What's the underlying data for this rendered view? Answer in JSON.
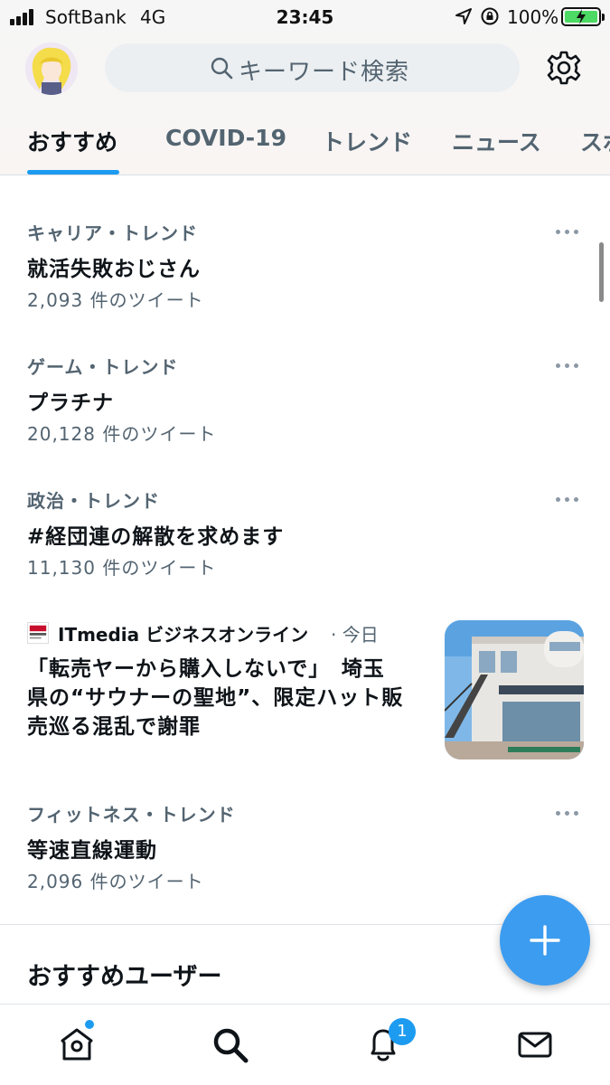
{
  "status_bar": {
    "carrier": "SoftBank",
    "network": "4G",
    "time": "23:45",
    "battery_percent": "100%"
  },
  "header": {
    "search_placeholder": "キーワード検索"
  },
  "tabs": [
    {
      "label": "おすすめ",
      "active": true
    },
    {
      "label": "COVID-19",
      "active": false
    },
    {
      "label": "トレンド",
      "active": false
    },
    {
      "label": "ニュース",
      "active": false
    },
    {
      "label": "スポ",
      "active": false
    }
  ],
  "trends": [
    {
      "category": "キャリア・トレンド",
      "name": "就活失敗おじさん",
      "count": "2,093 件のツイート"
    },
    {
      "category": "ゲーム・トレンド",
      "name": "プラチナ",
      "count": "20,128 件のツイート"
    },
    {
      "category": "政治・トレンド",
      "name": "#経団連の解散を求めます",
      "count": "11,130 件のツイート"
    },
    {
      "category": "フィットネス・トレンド",
      "name": "等速直線運動",
      "count": "2,096 件のツイート"
    }
  ],
  "news": {
    "source": "ITmedia ビジネスオンライン",
    "time": "· 今日",
    "headline_lines": [
      "「転売ヤーから購入しないで」　埼玉",
      "県の“サウナーの聖地”、限定ハット販",
      "売巡る混乱で謝罪"
    ]
  },
  "section": {
    "title": "おすすめユーザー"
  },
  "bottom_nav": {
    "notifications_badge": "1"
  },
  "colors": {
    "accent": "#1d9bf0",
    "secondary_text": "#536471",
    "fab": "#3c9cf0"
  }
}
